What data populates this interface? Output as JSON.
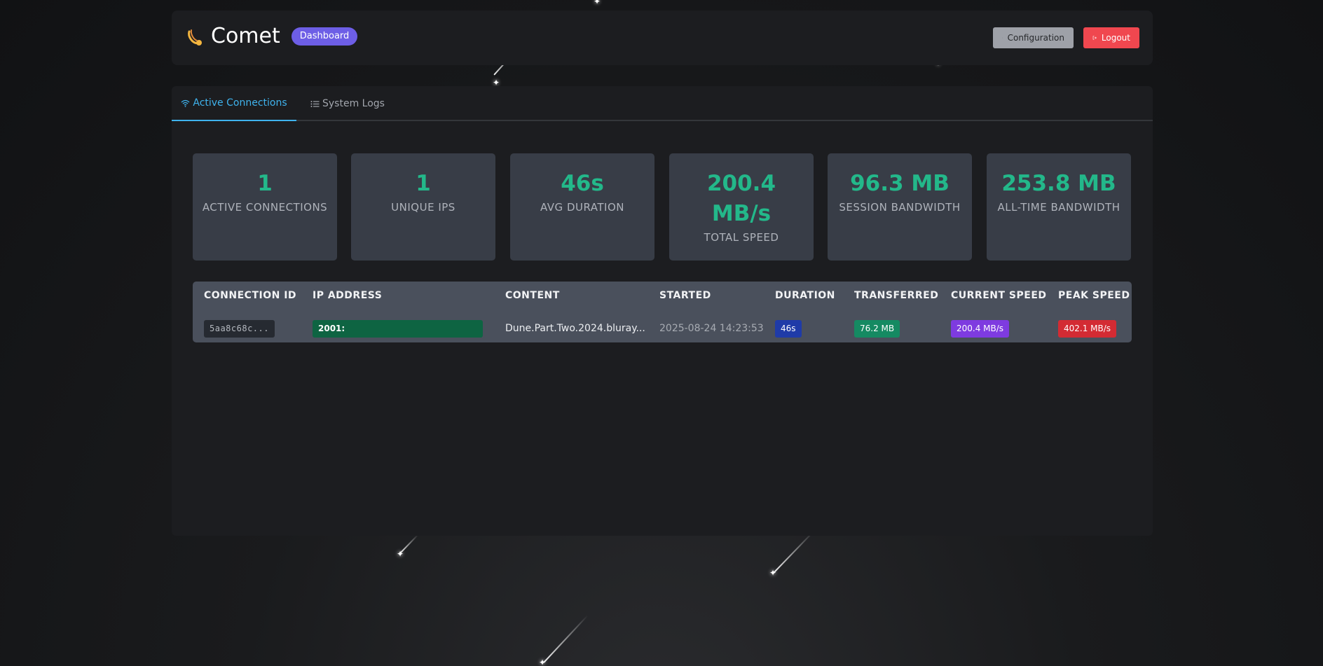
{
  "header": {
    "logo_icon": "comet-icon",
    "title": "Comet",
    "badge": "Dashboard",
    "buttons": {
      "configuration": "Configuration",
      "configuration_icon": "gear-icon",
      "logout": "Logout",
      "logout_icon": "logout-icon"
    }
  },
  "tabs": [
    {
      "label": "Active Connections",
      "icon": "wifi-icon",
      "active": true
    },
    {
      "label": "System Logs",
      "icon": "list-icon",
      "active": false
    }
  ],
  "stats": [
    {
      "value": "1",
      "label": "ACTIVE CONNECTIONS"
    },
    {
      "value": "1",
      "label": "UNIQUE IPS"
    },
    {
      "value": "46s",
      "label": "AVG DURATION"
    },
    {
      "value": "200.4 MB/s",
      "label": "TOTAL SPEED"
    },
    {
      "value": "96.3 MB",
      "label": "SESSION BANDWIDTH"
    },
    {
      "value": "253.8 MB",
      "label": "ALL-TIME BANDWIDTH"
    }
  ],
  "table": {
    "columns": [
      "CONNECTION ID",
      "IP ADDRESS",
      "CONTENT",
      "STARTED",
      "DURATION",
      "TRANSFERRED",
      "CURRENT SPEED",
      "PEAK SPEED"
    ],
    "rows": [
      {
        "connection_id": "5aa8c68c...",
        "ip_address": "2001:",
        "content": "Dune.Part.Two.2024.bluray...",
        "started": "2025-08-24 14:23:53",
        "duration": "46s",
        "transferred": "76.2 MB",
        "current_speed": "200.4 MB/s",
        "peak_speed": "402.1 MB/s"
      }
    ]
  },
  "colors": {
    "accent_green": "#23b88a",
    "tab_active": "#3fb3ee",
    "badge_purple": "#6d5ee6",
    "logout_red": "#f0474f"
  }
}
